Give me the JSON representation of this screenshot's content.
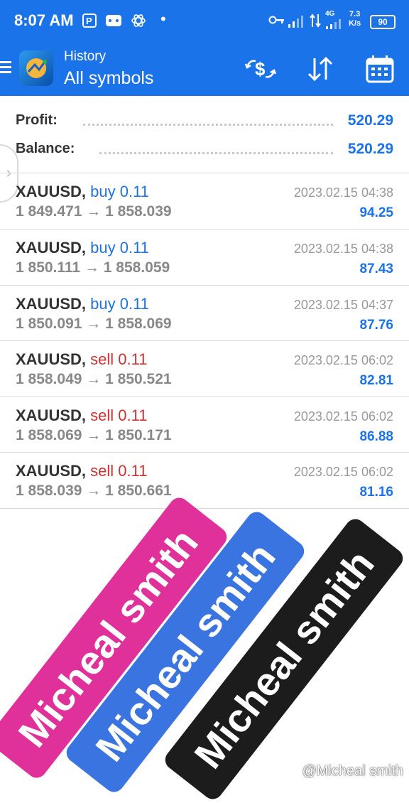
{
  "status_bar": {
    "time": "8:07 AM",
    "icons": [
      "parking-icon",
      "gamepad-icon",
      "atom-icon",
      "dot-icon"
    ],
    "network": "4G",
    "speed_value": "7.3",
    "speed_unit": "K/s",
    "battery": "90"
  },
  "toolbar": {
    "subtitle": "History",
    "title": "All symbols",
    "icons": [
      "menu-icon",
      "app-logo",
      "currency-exchange-icon",
      "sort-icon",
      "calendar-icon"
    ]
  },
  "summary": {
    "profit_label": "Profit:",
    "profit_value": "520.29",
    "balance_label": "Balance:",
    "balance_value": "520.29"
  },
  "deals": [
    {
      "symbol": "XAUUSD,",
      "side": "buy 0.11",
      "type": "buy",
      "open": "1 849.471",
      "arrow": "→",
      "close": "1 858.039",
      "date": "2023.02.15 04:38",
      "profit": "94.25"
    },
    {
      "symbol": "XAUUSD,",
      "side": "buy 0.11",
      "type": "buy",
      "open": "1 850.111",
      "arrow": "→",
      "close": "1 858.059",
      "date": "2023.02.15 04:38",
      "profit": "87.43"
    },
    {
      "symbol": "XAUUSD,",
      "side": "buy 0.11",
      "type": "buy",
      "open": "1 850.091",
      "arrow": "→",
      "close": "1 858.069",
      "date": "2023.02.15 04:37",
      "profit": "87.76"
    },
    {
      "symbol": "XAUUSD,",
      "side": "sell 0.11",
      "type": "sell",
      "open": "1 858.049",
      "arrow": "→",
      "close": "1 850.521",
      "date": "2023.02.15 06:02",
      "profit": "82.81"
    },
    {
      "symbol": "XAUUSD,",
      "side": "sell 0.11",
      "type": "sell",
      "open": "1 858.069",
      "arrow": "→",
      "close": "1 850.171",
      "date": "2023.02.15 06:02",
      "profit": "86.88"
    },
    {
      "symbol": "XAUUSD,",
      "side": "sell 0.11",
      "type": "sell",
      "open": "1 858.039",
      "arrow": "→",
      "close": "1 850.661",
      "date": "2023.02.15 06:02",
      "profit": "81.16"
    }
  ],
  "stamps": [
    {
      "text": "Micheal smith",
      "color": "#e0319a"
    },
    {
      "text": "Micheal smith",
      "color": "#3a74e0"
    },
    {
      "text": "Micheal smith",
      "color": "#1c1c1c"
    }
  ],
  "watermark": "@Micheal smith",
  "colors": {
    "accent": "#1a73e8",
    "buy": "#1a73e8",
    "sell": "#d32f2f",
    "profit": "#1a73e8"
  }
}
